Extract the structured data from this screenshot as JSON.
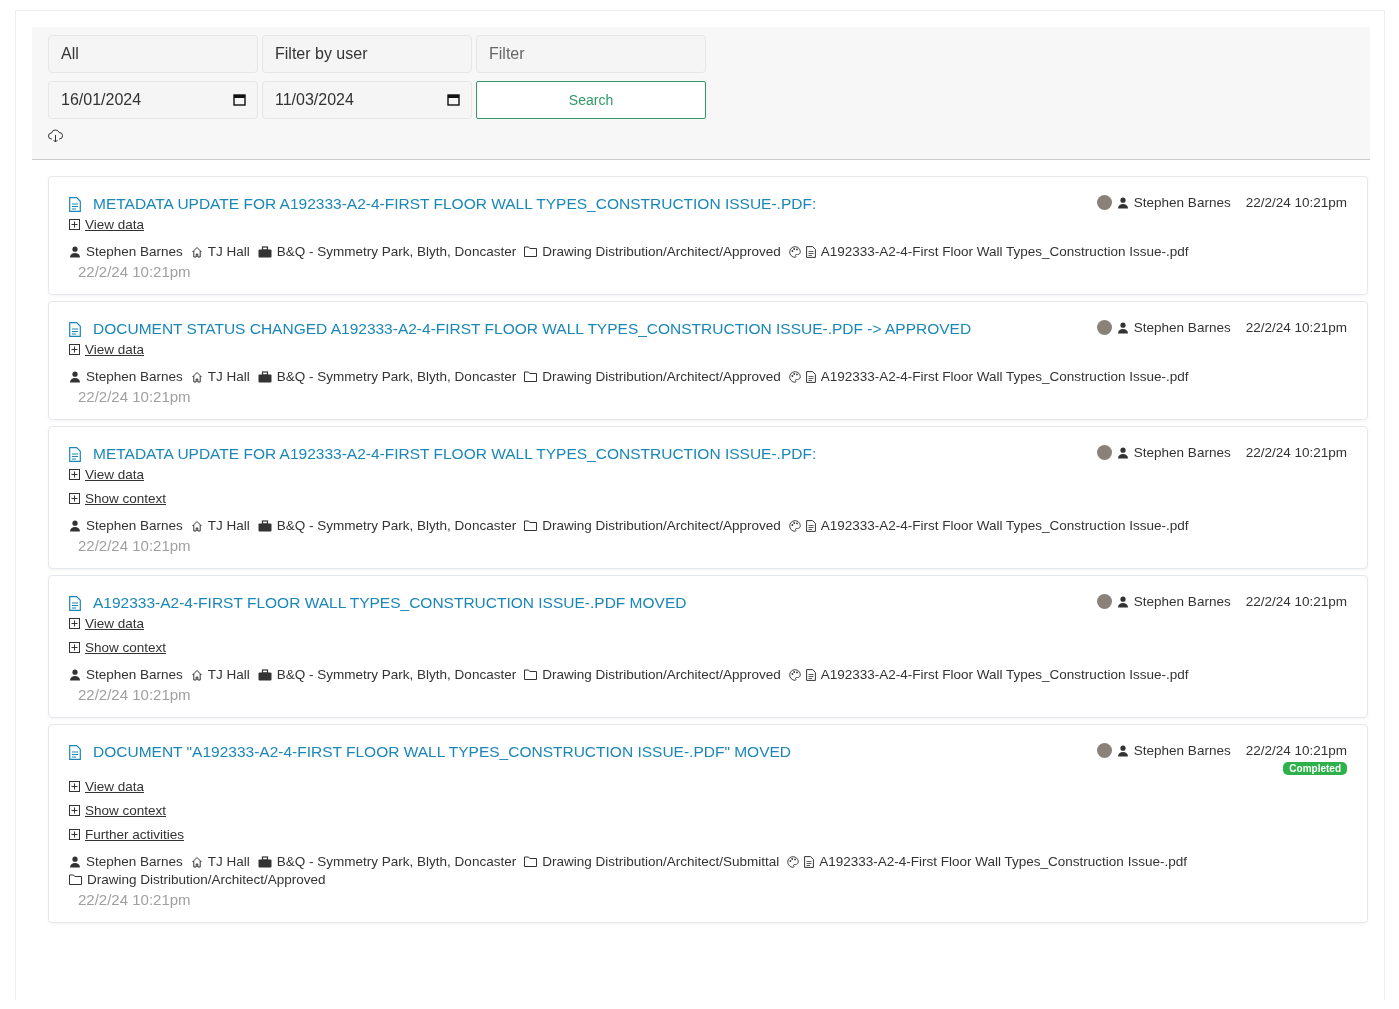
{
  "filters": {
    "type": {
      "value": "All"
    },
    "user": {
      "value": "Filter by user"
    },
    "text": {
      "placeholder": "Filter"
    },
    "from": {
      "value": "16/01/2024"
    },
    "to": {
      "value": "11/03/2024"
    },
    "search_button": "Search"
  },
  "activities": [
    {
      "title": "METADATA UPDATE FOR A192333-A2-4-FIRST FLOOR WALL TYPES_CONSTRUCTION ISSUE-.PDF:",
      "user": "Stephen Barnes",
      "time": "22/2/24 10:21pm",
      "links": [
        "View data"
      ],
      "meta": [
        {
          "kind": "user",
          "text": "Stephen Barnes"
        },
        {
          "kind": "site",
          "text": "TJ Hall"
        },
        {
          "kind": "project",
          "text": "B&Q - Symmetry Park, Blyth, Doncaster"
        },
        {
          "kind": "folder",
          "text": "Drawing Distribution/Architect/Approved"
        },
        {
          "kind": "file",
          "text": "A192333-A2-4-First Floor Wall Types_Construction Issue-.pdf"
        }
      ],
      "date": "22/2/24 10:21pm"
    },
    {
      "title": "DOCUMENT STATUS CHANGED A192333-A2-4-FIRST FLOOR WALL TYPES_CONSTRUCTION ISSUE-.PDF -> APPROVED",
      "user": "Stephen Barnes",
      "time": "22/2/24 10:21pm",
      "links": [
        "View data"
      ],
      "meta": [
        {
          "kind": "user",
          "text": "Stephen Barnes"
        },
        {
          "kind": "site",
          "text": "TJ Hall"
        },
        {
          "kind": "project",
          "text": "B&Q - Symmetry Park, Blyth, Doncaster"
        },
        {
          "kind": "folder",
          "text": "Drawing Distribution/Architect/Approved"
        },
        {
          "kind": "file",
          "text": "A192333-A2-4-First Floor Wall Types_Construction Issue-.pdf"
        }
      ],
      "date": "22/2/24 10:21pm"
    },
    {
      "title": "METADATA UPDATE FOR A192333-A2-4-FIRST FLOOR WALL TYPES_CONSTRUCTION ISSUE-.PDF:",
      "user": "Stephen Barnes",
      "time": "22/2/24 10:21pm",
      "links": [
        "View data",
        "Show context"
      ],
      "meta": [
        {
          "kind": "user",
          "text": "Stephen Barnes"
        },
        {
          "kind": "site",
          "text": "TJ Hall"
        },
        {
          "kind": "project",
          "text": "B&Q - Symmetry Park, Blyth, Doncaster"
        },
        {
          "kind": "folder",
          "text": "Drawing Distribution/Architect/Approved"
        },
        {
          "kind": "file",
          "text": "A192333-A2-4-First Floor Wall Types_Construction Issue-.pdf"
        }
      ],
      "date": "22/2/24 10:21pm"
    },
    {
      "title": "A192333-A2-4-FIRST FLOOR WALL TYPES_CONSTRUCTION ISSUE-.PDF MOVED",
      "user": "Stephen Barnes",
      "time": "22/2/24 10:21pm",
      "links": [
        "View data",
        "Show context"
      ],
      "meta": [
        {
          "kind": "user",
          "text": "Stephen Barnes"
        },
        {
          "kind": "site",
          "text": "TJ Hall"
        },
        {
          "kind": "project",
          "text": "B&Q - Symmetry Park, Blyth, Doncaster"
        },
        {
          "kind": "folder",
          "text": "Drawing Distribution/Architect/Approved"
        },
        {
          "kind": "file",
          "text": "A192333-A2-4-First Floor Wall Types_Construction Issue-.pdf"
        }
      ],
      "date": "22/2/24 10:21pm"
    },
    {
      "title": "DOCUMENT \"A192333-A2-4-FIRST FLOOR WALL TYPES_CONSTRUCTION ISSUE-.PDF\" MOVED",
      "user": "Stephen Barnes",
      "time": "22/2/24 10:21pm",
      "badge": "Completed",
      "links": [
        "View data",
        "Show context",
        "Further activities"
      ],
      "meta": [
        {
          "kind": "user",
          "text": "Stephen Barnes"
        },
        {
          "kind": "site",
          "text": "TJ Hall"
        },
        {
          "kind": "project",
          "text": "B&Q - Symmetry Park, Blyth, Doncaster"
        },
        {
          "kind": "folder",
          "text": "Drawing Distribution/Architect/Submittal"
        },
        {
          "kind": "file",
          "text": "A192333-A2-4-First Floor Wall Types_Construction Issue-.pdf"
        },
        {
          "kind": "folder",
          "text": "Drawing Distribution/Architect/Approved"
        }
      ],
      "date": "22/2/24 10:21pm"
    }
  ]
}
